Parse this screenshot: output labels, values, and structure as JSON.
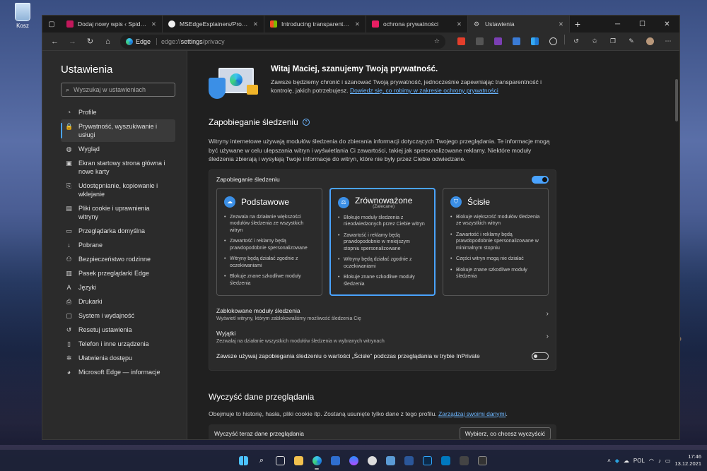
{
  "desktop": {
    "recycle_bin_label": "Kosz"
  },
  "tabs": [
    {
      "title": "Dodaj nowy wpis ‹ Spider's Web",
      "favicon_color": "#c2185b"
    },
    {
      "title": "MSEdgeExplainers/Program-Over...",
      "favicon_color": "#f0f0f0"
    },
    {
      "title": "Introducing transparent ads in M...",
      "favicon_color": "#f25022"
    },
    {
      "title": "ochrona prywatności",
      "favicon_color": "#e91e63"
    },
    {
      "title": "Ustawienia",
      "favicon_color": "#9e9e9e"
    }
  ],
  "address": {
    "brand": "Edge",
    "url_prefix": "edge://",
    "url_main": "settings",
    "url_rest": "/privacy"
  },
  "sidebar": {
    "title": "Ustawienia",
    "search_placeholder": "Wyszukaj w ustawieniach",
    "items": [
      {
        "label": "Profile",
        "icon": "user-icon",
        "glyph": "◔"
      },
      {
        "label": "Prywatność, wyszukiwanie i usługi",
        "icon": "lock-icon",
        "glyph": "🔒"
      },
      {
        "label": "Wygląd",
        "icon": "palette-icon",
        "glyph": "◍"
      },
      {
        "label": "Ekran startowy strona główna i nowe karty",
        "icon": "home-screen-icon",
        "glyph": "▣"
      },
      {
        "label": "Udostępnianie, kopiowanie i wklejanie",
        "icon": "share-icon",
        "glyph": "⎘"
      },
      {
        "label": "Pliki cookie i uprawnienia witryny",
        "icon": "cookie-icon",
        "glyph": "▤"
      },
      {
        "label": "Przeglądarka domyślna",
        "icon": "browser-icon",
        "glyph": "▭"
      },
      {
        "label": "Pobrane",
        "icon": "download-icon",
        "glyph": "↓"
      },
      {
        "label": "Bezpieczeństwo rodzinne",
        "icon": "family-icon",
        "glyph": "⚇"
      },
      {
        "label": "Pasek przeglądarki Edge",
        "icon": "sidebar-bar-icon",
        "glyph": "▥"
      },
      {
        "label": "Języki",
        "icon": "language-icon",
        "glyph": "A"
      },
      {
        "label": "Drukarki",
        "icon": "printer-icon",
        "glyph": "⎙"
      },
      {
        "label": "System i wydajność",
        "icon": "system-icon",
        "glyph": "▢"
      },
      {
        "label": "Resetuj ustawienia",
        "icon": "reset-icon",
        "glyph": "↺"
      },
      {
        "label": "Telefon i inne urządzenia",
        "icon": "phone-icon",
        "glyph": "▯"
      },
      {
        "label": "Ułatwienia dostępu",
        "icon": "accessibility-icon",
        "glyph": "✲"
      },
      {
        "label": "Microsoft Edge — informacje",
        "icon": "edge-icon",
        "glyph": "◕"
      }
    ]
  },
  "hero": {
    "title": "Witaj Maciej, szanujemy Twoją prywatność.",
    "body": "Zawsze będziemy chronić i szanować Twoją prywatność, jednocześnie zapewniając transparentność i kontrolę, jakich potrzebujesz.",
    "link": "Dowiedz się, co robimy w zakresie ochrony prywatności"
  },
  "tracking": {
    "section_title": "Zapobieganie śledzeniu",
    "description": "Witryny internetowe używają modułów śledzenia do zbierania informacji dotyczących Twojego przeglądania. Te informacje mogą być używane w celu ulepszania witryn i wyświetlania Ci zawartości, takiej jak spersonalizowane reklamy. Niektóre moduły śledzenia zbierają i wysyłają Twoje informacje do witryn, które nie były przez Ciebie odwiedzane.",
    "card_title": "Zapobieganie śledzeniu",
    "modes": [
      {
        "name": "Podstawowe",
        "sub": "",
        "bullets": [
          "Zezwala na działanie większości modułów śledzenia ze wszystkich witryn",
          "Zawartość i reklamy będą prawdopodobnie spersonalizowane",
          "Witryny będą działać zgodnie z oczekiwaniami",
          "Blokuje znane szkodliwe moduły śledzenia"
        ]
      },
      {
        "name": "Zrównoważone",
        "sub": "(Zalecane)",
        "bullets": [
          "Blokuje moduły śledzenia z nieodwiedzonych przez Ciebie witryn",
          "Zawartość i reklamy będą prawdopodobnie w mniejszym stopniu spersonalizowane",
          "Witryny będą działać zgodnie z oczekiwaniami",
          "Blokuje znane szkodliwe moduły śledzenia"
        ]
      },
      {
        "name": "Ścisłe",
        "sub": "",
        "bullets": [
          "Blokuje większość modułów śledzenia ze wszystkich witryn",
          "Zawartość i reklamy będą prawdopodobnie spersonalizowane w minimalnym stopniu",
          "Części witryn mogą nie działać",
          "Blokuje znane szkodliwe moduły śledzenia"
        ]
      }
    ],
    "blocked_title": "Zablokowane moduły śledzenia",
    "blocked_sub": "Wyświetl witryny, którym zablokowaliśmy możliwość śledzenia Cię",
    "exceptions_title": "Wyjątki",
    "exceptions_sub": "Zezwalaj na działanie wszystkich modułów śledzenia w wybranych witrynach",
    "inprivate_label": "Zawsze używaj zapobiegania śledzeniu o wartości „Ścisłe” podczas przeglądania w trybie InPrivate"
  },
  "clear": {
    "title": "Wyczyść dane przeglądania",
    "desc": "Obejmuje to historię, hasła, pliki cookie itp. Zostaną usunięte tylko dane z tego profilu.",
    "link": "Zarządzaj swoimi danymi",
    "row_label": "Wyczyść teraz dane przeglądania",
    "button": "Wybierz, co chcesz wyczyścić"
  },
  "taskbar": {
    "time": "17:46",
    "date": "13.12.2021",
    "lang": "POL"
  },
  "colors": {
    "accent": "#4aa3ff"
  }
}
